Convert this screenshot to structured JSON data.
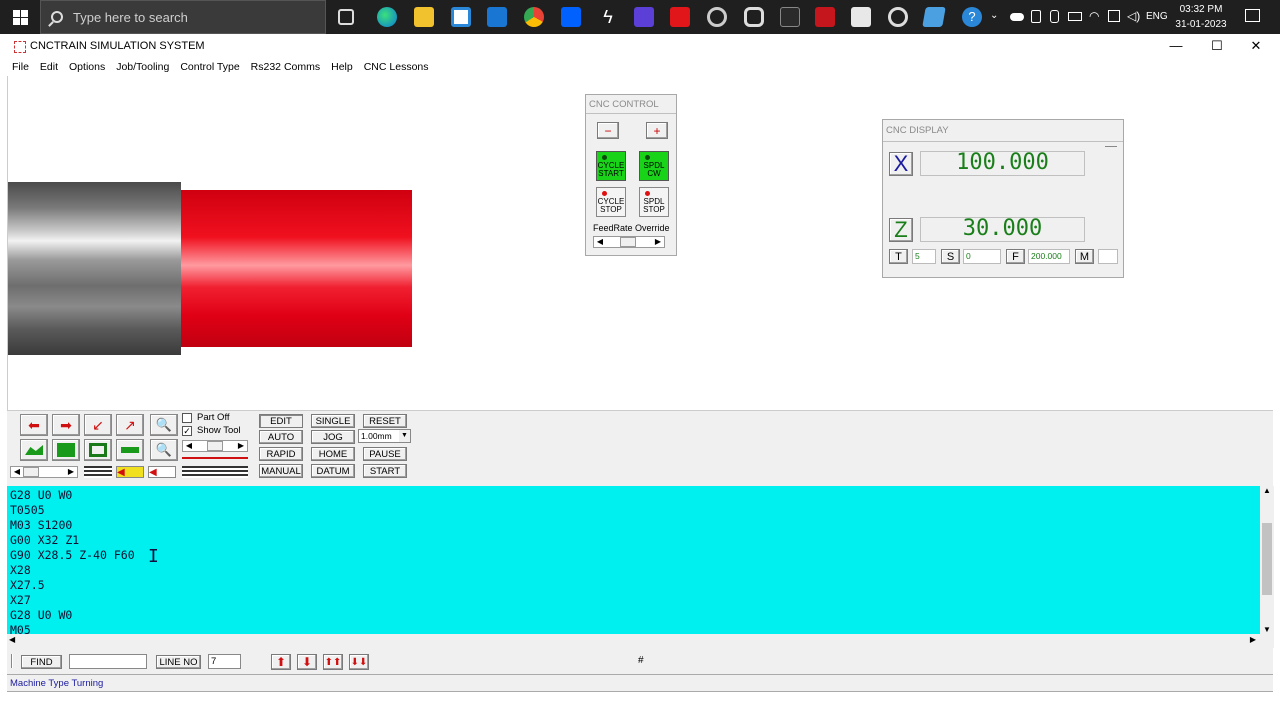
{
  "taskbar": {
    "search_placeholder": "Type here to search",
    "language": "ENG",
    "time": "03:32 PM",
    "date": "31-01-2023"
  },
  "window": {
    "title": "CNCTRAIN SIMULATION SYSTEM",
    "minimize": "—",
    "maximize": "☐",
    "close": "✕"
  },
  "menu": [
    "File",
    "Edit",
    "Options",
    "Job/Tooling",
    "Control Type",
    "Rs232 Comms",
    "Help",
    "CNC Lessons"
  ],
  "cnc_control": {
    "title": "CNC CONTROL",
    "minus": "−",
    "plus": "+",
    "cycle_start": "CYCLE START",
    "spdl_cw": "SPDL CW",
    "cycle_stop": "CYCLE STOP",
    "spdl_stop": "SPDL STOP",
    "feedrate_label": "FeedRate Override"
  },
  "cnc_display": {
    "title": "CNC DISPLAY",
    "x_label": "X",
    "x_value": "100.000",
    "z_label": "Z",
    "z_value": "30.000",
    "t_label": "T",
    "t_value": "5",
    "s_label": "S",
    "s_value": "0",
    "f_label": "F",
    "f_value": "200.000",
    "m_label": "M",
    "m_value": ""
  },
  "toolbar": {
    "part_off": "Part Off",
    "show_tool": "Show Tool",
    "show_tool_checked": true,
    "edit": "EDIT",
    "single": "SINGLE",
    "reset": "RESET",
    "auto": "AUTO",
    "jog": "JOG",
    "jog_step": "1.00mm",
    "rapid": "RAPID",
    "home": "HOME",
    "pause": "PAUSE",
    "manual": "MANUAL",
    "datum": "DATUM",
    "start": "START"
  },
  "program": [
    "G28 U0 W0",
    "T0505",
    "M03 S1200",
    "G00 X32 Z1",
    "G90 X28.5 Z-40 F60",
    "X28",
    "X27.5",
    "X27",
    "G28 U0 W0",
    "M05"
  ],
  "findbar": {
    "find": "FIND",
    "find_value": "",
    "line_no": "LINE NO",
    "line_value": "7",
    "hash": "#"
  },
  "status": {
    "machine_type_label": "Machine Type",
    "machine_type": "Turning"
  }
}
